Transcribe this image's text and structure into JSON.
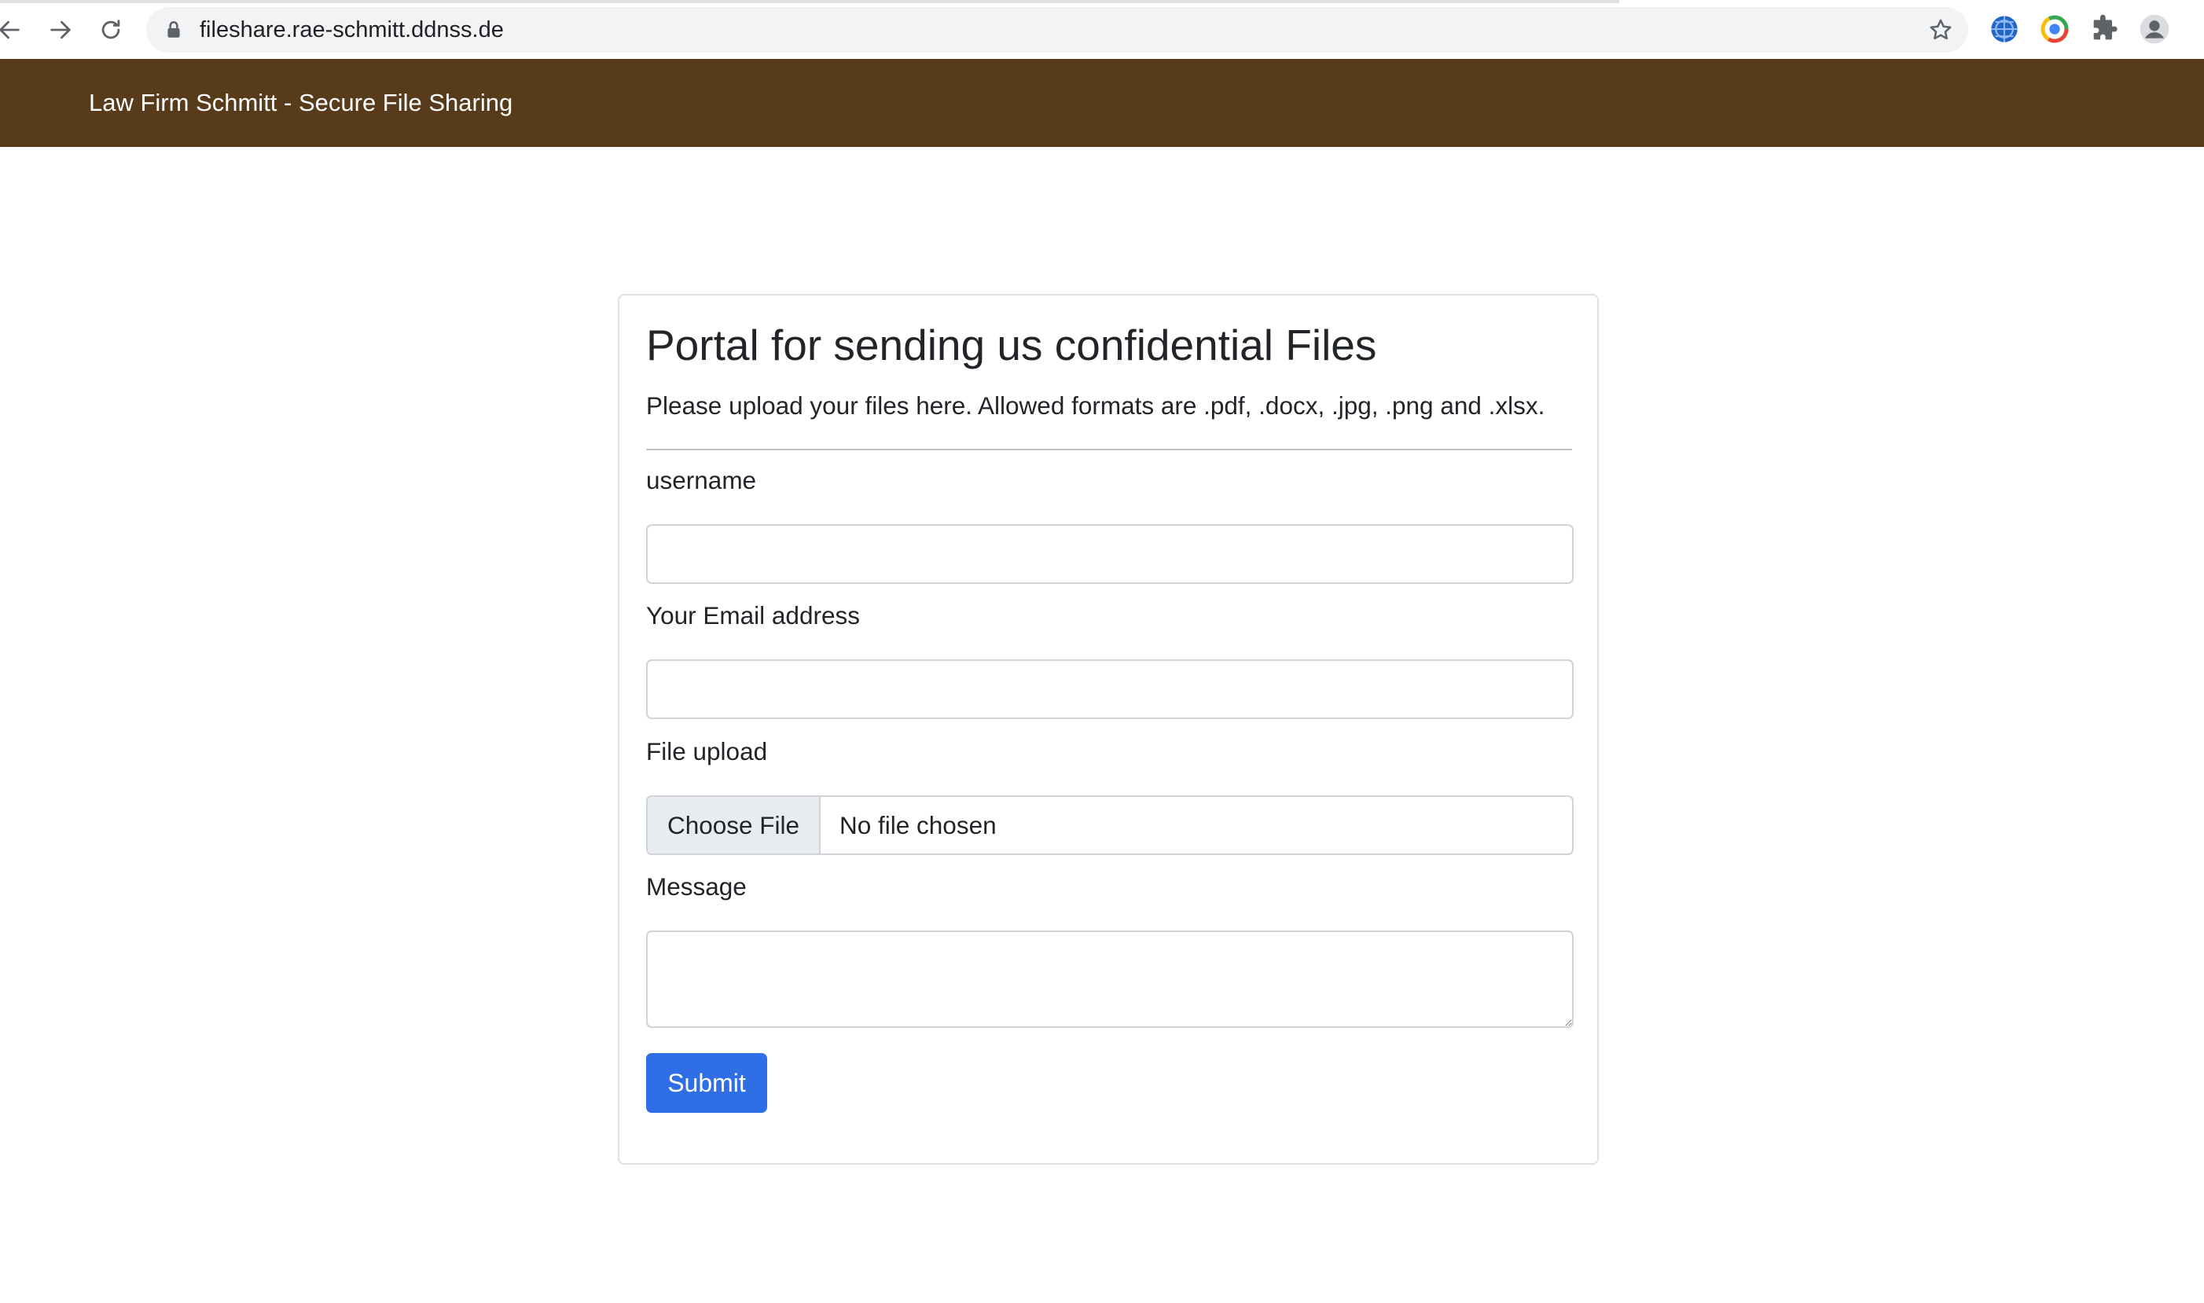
{
  "browser": {
    "url": "fileshare.rae-schmitt.ddnss.de",
    "icons": {
      "back": "arrow-left-icon",
      "forward": "arrow-right-icon",
      "reload": "reload-icon",
      "lock": "lock-icon",
      "bookmark": "star-icon",
      "extension_1": "globe-icon",
      "extension_2": "chrome-ring-icon",
      "extensions": "puzzle-icon",
      "profile": "profile-icon"
    }
  },
  "navbar": {
    "brand": "Law Firm Schmitt - Secure File Sharing",
    "background_color": "#583b1a"
  },
  "card": {
    "title": "Portal for sending us confidential Files",
    "lead": "Please upload your files here. Allowed formats are .pdf, .docx, .jpg, .png and .xlsx.",
    "fields": {
      "username_label": "username",
      "username_value": "",
      "email_label": "Your Email address",
      "email_value": "",
      "file_label": "File upload",
      "file_button": "Choose File",
      "file_status": "No file chosen",
      "message_label": "Message",
      "message_value": ""
    },
    "submit_label": "Submit",
    "submit_color": "#2f6ee5"
  }
}
